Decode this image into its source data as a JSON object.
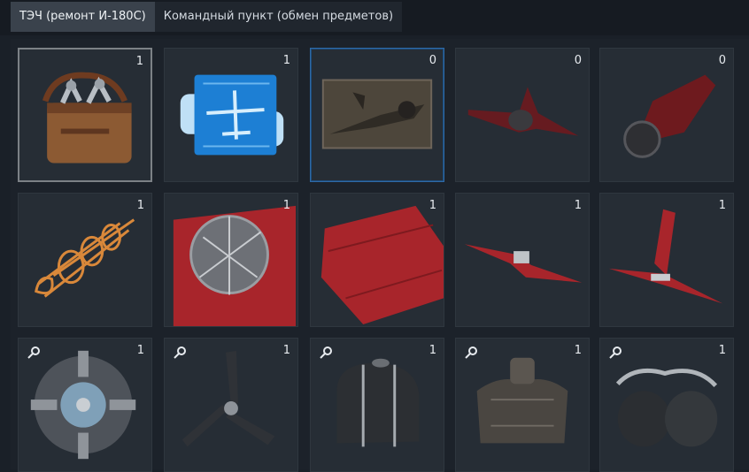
{
  "tabs": [
    {
      "label": "ТЭЧ (ремонт И-180С)",
      "active": true
    },
    {
      "label": "Командный пункт (обмен предметов)",
      "active": false
    }
  ],
  "items": [
    {
      "name": "toolbag",
      "count": "1",
      "search": false
    },
    {
      "name": "blueprint",
      "count": "1",
      "search": false
    },
    {
      "name": "photo-aircraft",
      "count": "0",
      "search": false
    },
    {
      "name": "red-aircraft-silhouette",
      "count": "0",
      "search": false
    },
    {
      "name": "red-fuselage-silhouette",
      "count": "0",
      "search": false
    },
    {
      "name": "fuselage-frame",
      "count": "1",
      "search": false
    },
    {
      "name": "engine-frame",
      "count": "1",
      "search": false
    },
    {
      "name": "wing-panel",
      "count": "1",
      "search": false
    },
    {
      "name": "wing-assembly",
      "count": "1",
      "search": false
    },
    {
      "name": "tail-assembly",
      "count": "1",
      "search": false
    },
    {
      "name": "radial-engine",
      "count": "1",
      "search": true
    },
    {
      "name": "propeller",
      "count": "1",
      "search": true
    },
    {
      "name": "fuel-tank",
      "count": "1",
      "search": true
    },
    {
      "name": "oil-tank",
      "count": "1",
      "search": true
    },
    {
      "name": "twin-tanks",
      "count": "1",
      "search": true
    }
  ],
  "colors": {
    "accent_blue": "#2f6aa6",
    "red_part": "#a8252b",
    "bg": "#1a2028"
  }
}
